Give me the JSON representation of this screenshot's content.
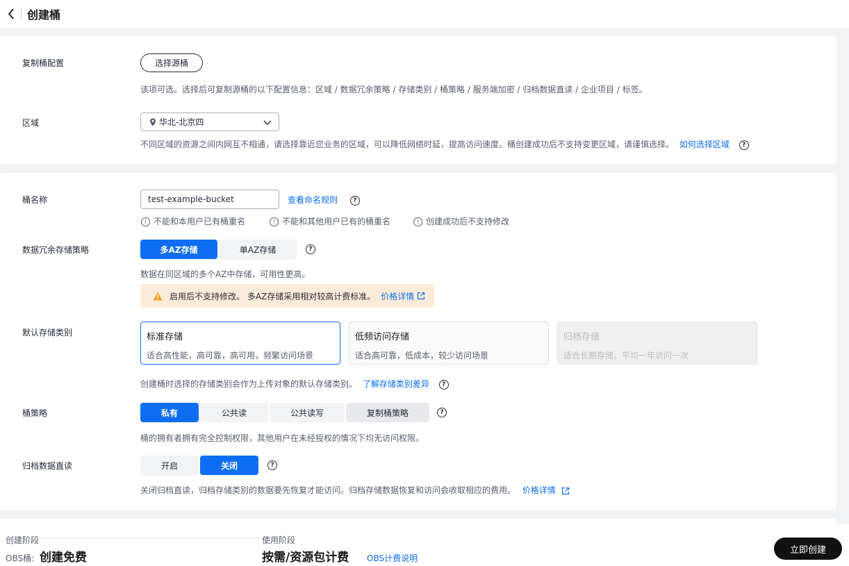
{
  "header": {
    "title": "创建桶"
  },
  "replicate": {
    "label": "复制桶配置",
    "button": "选择源桶",
    "hint": "该项可选。选择后可复制源桶的以下配置信息：区域 / 数据冗余策略 / 存储类别 / 桶策略 / 服务端加密 / 归档数据直读 / 企业项目 / 标签。"
  },
  "region": {
    "label": "区域",
    "value": "华北-北京四",
    "hint": "不同区域的资源之间内网互不相通，请选择靠近您业务的区域，可以降低网络时延，提高访问速度。桶创建成功后不支持变更区域，请谨慎选择。",
    "link": "如何选择区域"
  },
  "bucket_name": {
    "label": "桶名称",
    "value": "test-example-bucket",
    "link": "查看命名规则",
    "rules": [
      "不能和本用户已有桶重名",
      "不能和其他用户已有的桶重名",
      "创建成功后不支持修改"
    ]
  },
  "redundancy": {
    "label": "数据冗余存储策略",
    "options": [
      "多AZ存储",
      "单AZ存储"
    ],
    "selected": 0,
    "hint": "数据在同区域的多个AZ中存储，可用性更高。",
    "warning": "启用后不支持修改。 多AZ存储采用相对较高计费标准。",
    "warning_link": "价格详情"
  },
  "storage_class": {
    "label": "默认存储类别",
    "cards": [
      {
        "title": "标准存储",
        "desc": "适合高性能，高可靠，高可用，频繁访问场景"
      },
      {
        "title": "低频访问存储",
        "desc": "适合高可靠，低成本，较少访问场景"
      },
      {
        "title": "归档存储",
        "desc": "适合长期存储，平均一年访问一次"
      }
    ],
    "hint": "创建桶时选择的存储类别会作为上传对象的默认存储类别。",
    "link": "了解存储类别差异"
  },
  "policy": {
    "label": "桶策略",
    "options": [
      "私有",
      "公共读",
      "公共读写",
      "复制桶策略"
    ],
    "hint": "桶的拥有者拥有完全控制权限，其他用户在未经授权的情况下均无访问权限。"
  },
  "archive_read": {
    "label": "归档数据直读",
    "options": [
      "开启",
      "关闭"
    ],
    "hint": "关闭归档直读，归档存储类别的数据要先恢复才能访问。归档存储数据恢复和访问会收取相应的费用。",
    "link": "价格详情"
  },
  "footer": {
    "stage1_label": "创建阶段",
    "stage1_prefix": "OBS桶:",
    "stage1_value": "创建免费",
    "stage2_label": "使用阶段",
    "stage2_value": "按需/资源包计费",
    "billing_link": "OBS计费说明",
    "create_button": "立即创建"
  }
}
